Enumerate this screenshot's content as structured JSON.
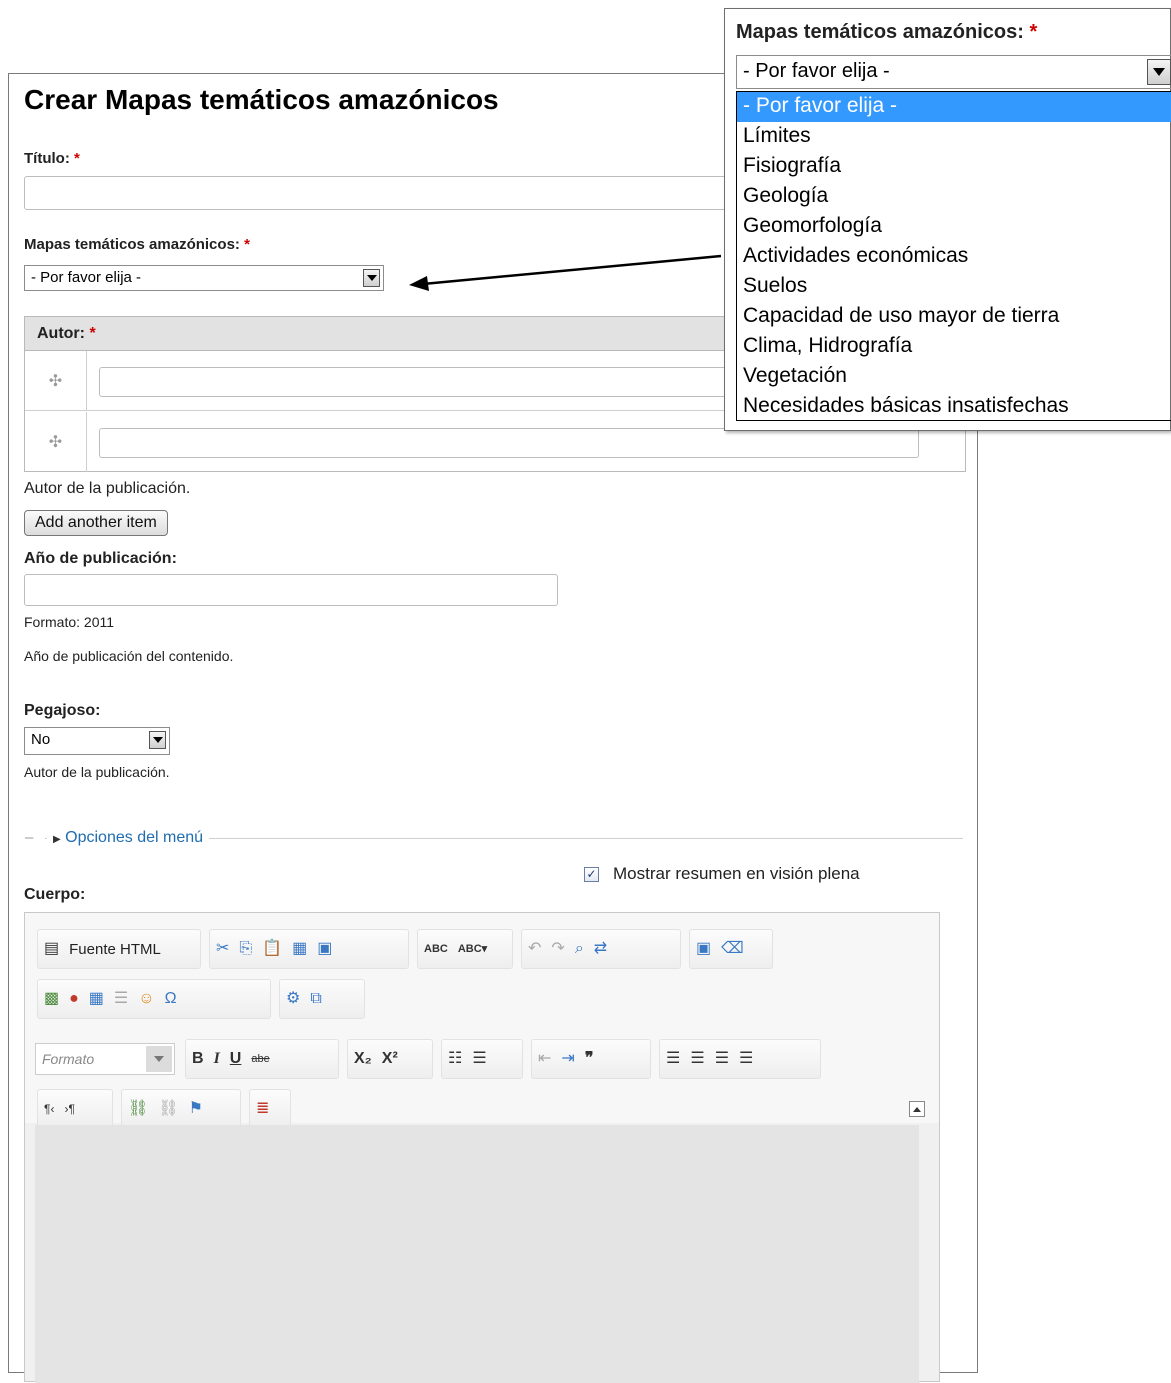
{
  "page": {
    "title": "Crear Mapas temáticos amazónicos",
    "required_mark": "*"
  },
  "titulo": {
    "label": "Título:",
    "value": ""
  },
  "mapas": {
    "label": "Mapas temáticos amazónicos:",
    "selected": "- Por favor elija -"
  },
  "autor": {
    "header": "Autor:",
    "description": "Autor de la publicación.",
    "add_button": "Add another item"
  },
  "anio": {
    "label": "Año de publicación:",
    "format": "Formato: 2011",
    "description": "Año de publicación del contenido."
  },
  "pegajoso": {
    "label": "Pegajoso:",
    "selected": "No",
    "description": "Autor de la publicación."
  },
  "menu_options": {
    "legend": "Opciones del menú",
    "bullet": "–"
  },
  "summary_toggle": {
    "label": "Mostrar resumen en visión plena",
    "checked": true
  },
  "cuerpo": {
    "label": "Cuerpo:"
  },
  "editor": {
    "source_button": "Fuente HTML",
    "format_placeholder": "Formato",
    "toolbar": {
      "bold": "B",
      "italic": "I",
      "underline": "U",
      "strike": "abe",
      "subscript": "X₂",
      "superscript": "X²"
    }
  },
  "dropdown_popup": {
    "label": "Mapas temáticos amazónicos:",
    "selected": "- Por favor elija -",
    "options": [
      "- Por favor elija -",
      "Límites",
      "Fisiografía",
      "Geología",
      "Geomorfología",
      "Actividades económicas",
      "Suelos",
      "Capacidad de uso mayor de tierra",
      "Clima, Hidrografía",
      "Vegetación",
      "Necesidades básicas insatisfechas"
    ]
  }
}
